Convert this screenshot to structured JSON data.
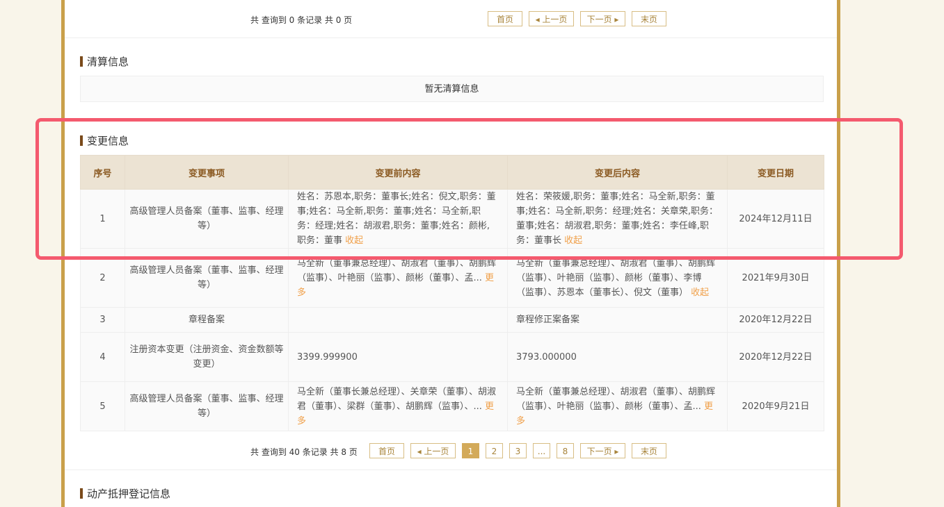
{
  "top_pager": {
    "info": "共 查询到 0 条记录 共 0 页",
    "first": "首页",
    "prev": "◂ 上一页",
    "next": "下一页 ▸",
    "last": "末页"
  },
  "liquidation": {
    "title": "清算信息",
    "empty": "暂无清算信息"
  },
  "changes": {
    "title": "变更信息",
    "headers": [
      "序号",
      "变更事项",
      "变更前内容",
      "变更后内容",
      "变更日期"
    ],
    "rows": [
      {
        "no": "1",
        "item": "高级管理人员备案（董事、监事、经理等）",
        "before": "姓名：苏恩本,职务：董事长;姓名：倪文,职务：董事;姓名：马全新,职务：董事;姓名：马全新,职务：经理;姓名：胡淑君,职务：董事;姓名：颜彬,职务：董事",
        "before_link": "收起",
        "after": "姓名：荣筱媛,职务：董事;姓名：马全新,职务：董事;姓名：马全新,职务：经理;姓名：关章荣,职务：董事;姓名：胡淑君,职务：董事;姓名：李任峰,职务：董事长",
        "after_link": "收起",
        "date": "2024年12月11日"
      },
      {
        "no": "2",
        "item": "高级管理人员备案（董事、监事、经理等）",
        "before": "马全新（董事兼总经理）、胡淑君（董事）、胡鹏辉（监事）、叶艳丽（监事）、颜彬（董事）、孟...",
        "before_link": "更多",
        "after": "马全新（董事兼总经理）、胡淑君（董事）、胡鹏辉（监事）、叶艳丽（监事）、颜彬（董事）、李博（监事）、苏恩本（董事长）、倪文（董事）",
        "after_link": "收起",
        "date": "2021年9月30日"
      },
      {
        "no": "3",
        "item": "章程备案",
        "before": "",
        "before_link": "",
        "after": "章程修正案备案",
        "after_link": "",
        "date": "2020年12月22日"
      },
      {
        "no": "4",
        "item": "注册资本变更（注册资金、资金数额等变更）",
        "before": "3399.999900",
        "before_link": "",
        "after": "3793.000000",
        "after_link": "",
        "date": "2020年12月22日"
      },
      {
        "no": "5",
        "item": "高级管理人员备案（董事、监事、经理等）",
        "before": "马全新（董事长兼总经理）、关章荣（董事）、胡淑君（董事）、梁群（董事）、胡鹏辉（监事）、...",
        "before_link": "更多",
        "after": "马全新（董事兼总经理）、胡淑君（董事）、胡鹏辉（监事）、叶艳丽（监事）、颜彬（董事）、孟...",
        "after_link": "更多",
        "date": "2020年9月21日"
      }
    ]
  },
  "bottom_pager": {
    "info": "共 查询到 40 条记录 共 8 页",
    "first": "首页",
    "prev": "◂ 上一页",
    "pages": [
      "1",
      "2",
      "3",
      "...",
      "8"
    ],
    "next": "下一页 ▸",
    "last": "末页"
  },
  "mortgage": {
    "title": "动产抵押登记信息"
  },
  "colors": {
    "gold_border": "#c9a04a",
    "header_bg": "#ece3d3",
    "header_text": "#8b5a22",
    "link": "#f0a04a",
    "highlight": "#f45a6e"
  }
}
